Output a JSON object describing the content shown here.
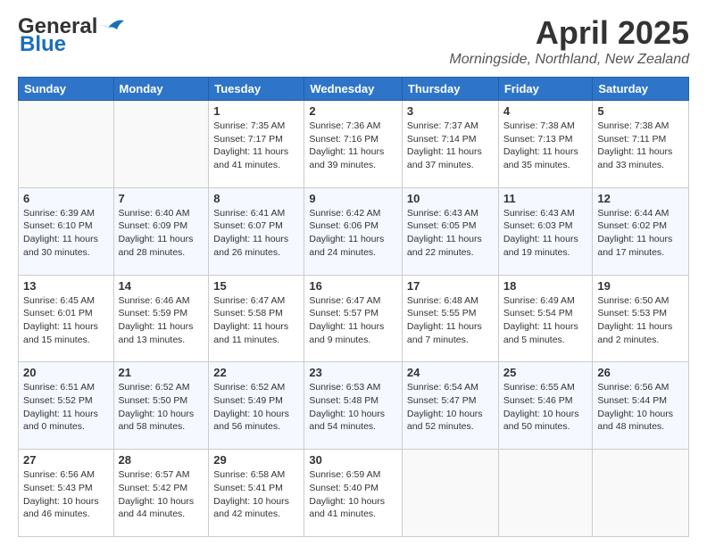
{
  "header": {
    "logo_line1": "General",
    "logo_line2": "Blue",
    "title": "April 2025",
    "subtitle": "Morningside, Northland, New Zealand"
  },
  "days_of_week": [
    "Sunday",
    "Monday",
    "Tuesday",
    "Wednesday",
    "Thursday",
    "Friday",
    "Saturday"
  ],
  "weeks": [
    [
      {
        "day": "",
        "info": ""
      },
      {
        "day": "",
        "info": ""
      },
      {
        "day": "1",
        "info": "Sunrise: 7:35 AM\nSunset: 7:17 PM\nDaylight: 11 hours and 41 minutes."
      },
      {
        "day": "2",
        "info": "Sunrise: 7:36 AM\nSunset: 7:16 PM\nDaylight: 11 hours and 39 minutes."
      },
      {
        "day": "3",
        "info": "Sunrise: 7:37 AM\nSunset: 7:14 PM\nDaylight: 11 hours and 37 minutes."
      },
      {
        "day": "4",
        "info": "Sunrise: 7:38 AM\nSunset: 7:13 PM\nDaylight: 11 hours and 35 minutes."
      },
      {
        "day": "5",
        "info": "Sunrise: 7:38 AM\nSunset: 7:11 PM\nDaylight: 11 hours and 33 minutes."
      }
    ],
    [
      {
        "day": "6",
        "info": "Sunrise: 6:39 AM\nSunset: 6:10 PM\nDaylight: 11 hours and 30 minutes."
      },
      {
        "day": "7",
        "info": "Sunrise: 6:40 AM\nSunset: 6:09 PM\nDaylight: 11 hours and 28 minutes."
      },
      {
        "day": "8",
        "info": "Sunrise: 6:41 AM\nSunset: 6:07 PM\nDaylight: 11 hours and 26 minutes."
      },
      {
        "day": "9",
        "info": "Sunrise: 6:42 AM\nSunset: 6:06 PM\nDaylight: 11 hours and 24 minutes."
      },
      {
        "day": "10",
        "info": "Sunrise: 6:43 AM\nSunset: 6:05 PM\nDaylight: 11 hours and 22 minutes."
      },
      {
        "day": "11",
        "info": "Sunrise: 6:43 AM\nSunset: 6:03 PM\nDaylight: 11 hours and 19 minutes."
      },
      {
        "day": "12",
        "info": "Sunrise: 6:44 AM\nSunset: 6:02 PM\nDaylight: 11 hours and 17 minutes."
      }
    ],
    [
      {
        "day": "13",
        "info": "Sunrise: 6:45 AM\nSunset: 6:01 PM\nDaylight: 11 hours and 15 minutes."
      },
      {
        "day": "14",
        "info": "Sunrise: 6:46 AM\nSunset: 5:59 PM\nDaylight: 11 hours and 13 minutes."
      },
      {
        "day": "15",
        "info": "Sunrise: 6:47 AM\nSunset: 5:58 PM\nDaylight: 11 hours and 11 minutes."
      },
      {
        "day": "16",
        "info": "Sunrise: 6:47 AM\nSunset: 5:57 PM\nDaylight: 11 hours and 9 minutes."
      },
      {
        "day": "17",
        "info": "Sunrise: 6:48 AM\nSunset: 5:55 PM\nDaylight: 11 hours and 7 minutes."
      },
      {
        "day": "18",
        "info": "Sunrise: 6:49 AM\nSunset: 5:54 PM\nDaylight: 11 hours and 5 minutes."
      },
      {
        "day": "19",
        "info": "Sunrise: 6:50 AM\nSunset: 5:53 PM\nDaylight: 11 hours and 2 minutes."
      }
    ],
    [
      {
        "day": "20",
        "info": "Sunrise: 6:51 AM\nSunset: 5:52 PM\nDaylight: 11 hours and 0 minutes."
      },
      {
        "day": "21",
        "info": "Sunrise: 6:52 AM\nSunset: 5:50 PM\nDaylight: 10 hours and 58 minutes."
      },
      {
        "day": "22",
        "info": "Sunrise: 6:52 AM\nSunset: 5:49 PM\nDaylight: 10 hours and 56 minutes."
      },
      {
        "day": "23",
        "info": "Sunrise: 6:53 AM\nSunset: 5:48 PM\nDaylight: 10 hours and 54 minutes."
      },
      {
        "day": "24",
        "info": "Sunrise: 6:54 AM\nSunset: 5:47 PM\nDaylight: 10 hours and 52 minutes."
      },
      {
        "day": "25",
        "info": "Sunrise: 6:55 AM\nSunset: 5:46 PM\nDaylight: 10 hours and 50 minutes."
      },
      {
        "day": "26",
        "info": "Sunrise: 6:56 AM\nSunset: 5:44 PM\nDaylight: 10 hours and 48 minutes."
      }
    ],
    [
      {
        "day": "27",
        "info": "Sunrise: 6:56 AM\nSunset: 5:43 PM\nDaylight: 10 hours and 46 minutes."
      },
      {
        "day": "28",
        "info": "Sunrise: 6:57 AM\nSunset: 5:42 PM\nDaylight: 10 hours and 44 minutes."
      },
      {
        "day": "29",
        "info": "Sunrise: 6:58 AM\nSunset: 5:41 PM\nDaylight: 10 hours and 42 minutes."
      },
      {
        "day": "30",
        "info": "Sunrise: 6:59 AM\nSunset: 5:40 PM\nDaylight: 10 hours and 41 minutes."
      },
      {
        "day": "",
        "info": ""
      },
      {
        "day": "",
        "info": ""
      },
      {
        "day": "",
        "info": ""
      }
    ]
  ]
}
